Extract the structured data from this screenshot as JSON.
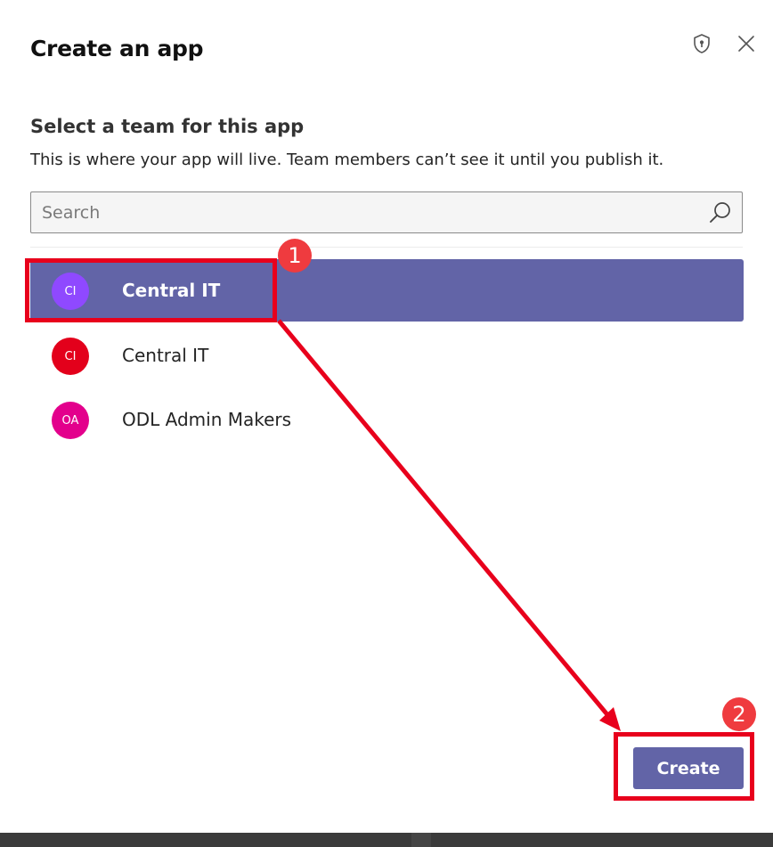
{
  "dialog": {
    "title": "Create an app"
  },
  "header_icons": [
    "shield-icon",
    "close-icon"
  ],
  "section": {
    "title": "Select a team for this app",
    "description": "This is where your app will live. Team members can’t see it until you publish it."
  },
  "search": {
    "placeholder": "Search",
    "value": ""
  },
  "teams": [
    {
      "initials": "CI",
      "name": "Central IT",
      "avatar_color": "#8f49ff",
      "selected": true
    },
    {
      "initials": "CI",
      "name": "Central IT",
      "avatar_color": "#e3001b",
      "selected": false
    },
    {
      "initials": "OA",
      "name": "ODL Admin Makers",
      "avatar_color": "#e3008c",
      "selected": false
    }
  ],
  "footer": {
    "create_label": "Create"
  },
  "annotations": {
    "step1": "1",
    "step2": "2"
  },
  "colors": {
    "accent": "#6264a7",
    "annotation_red": "#e8001c",
    "badge_red": "#ef3b3f"
  }
}
